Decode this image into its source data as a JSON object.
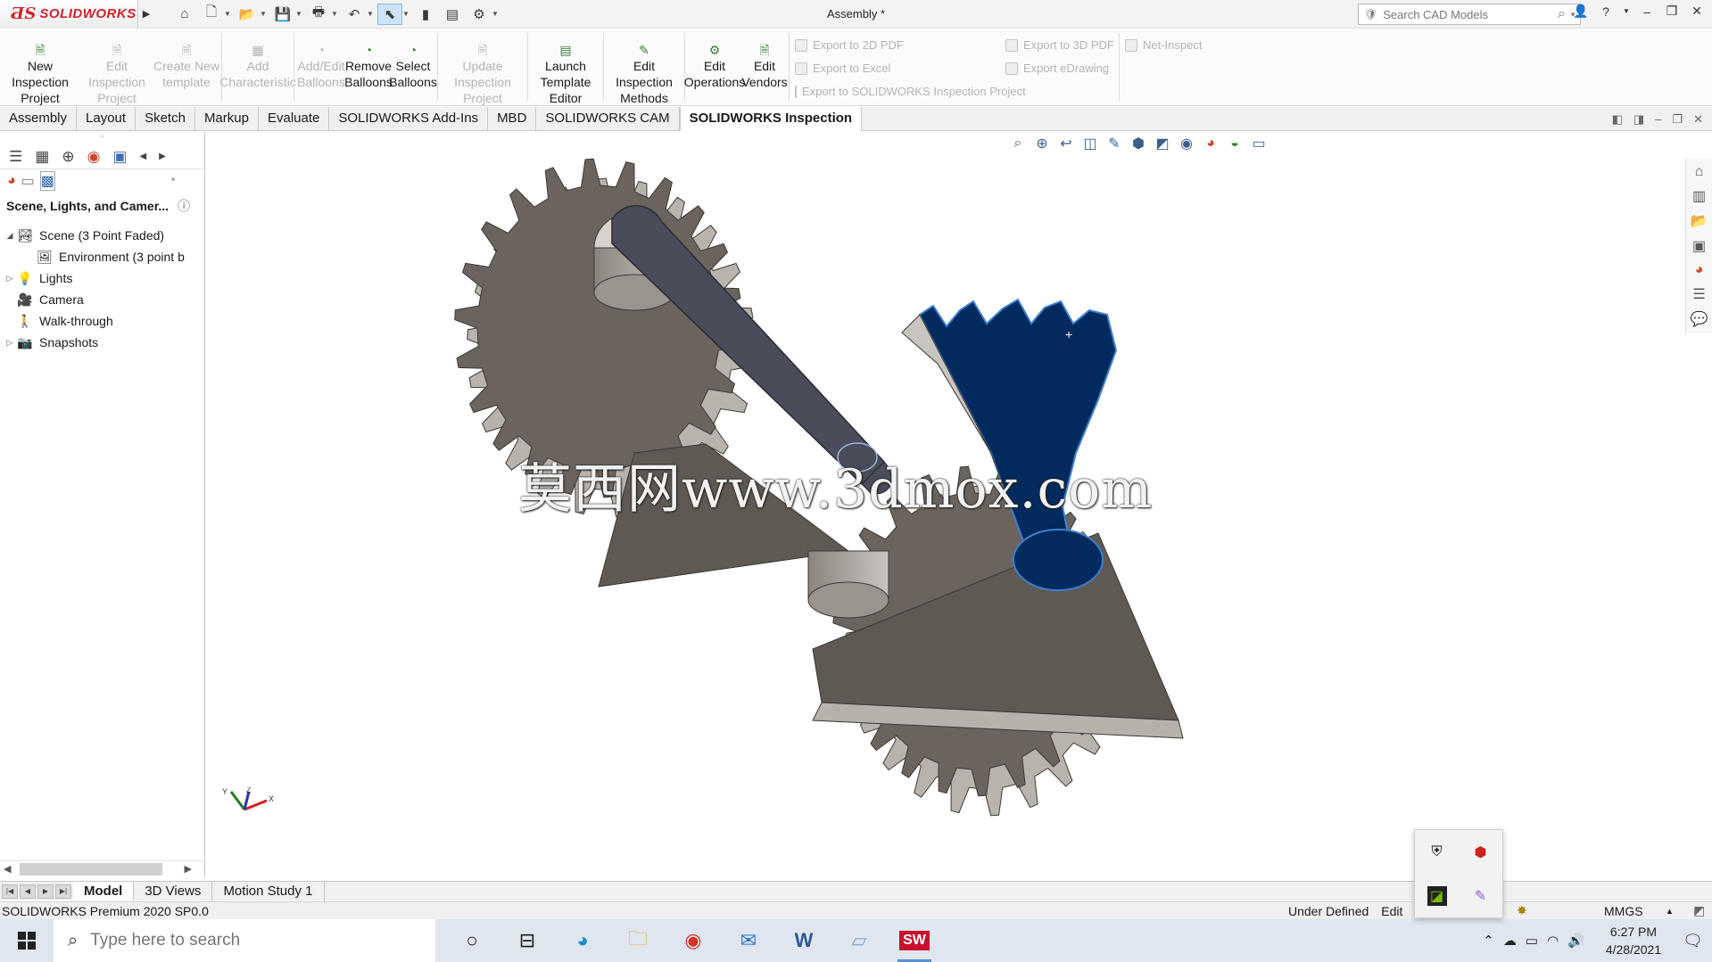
{
  "app": {
    "brand": "SOLIDWORKS",
    "document_title": "Assembly *",
    "search_placeholder": "Search CAD Models"
  },
  "command_manager": {
    "buttons": [
      {
        "label": "New Inspection\nProject",
        "enabled": true
      },
      {
        "label": "Edit Inspection\nProject",
        "enabled": false
      },
      {
        "label": "Create New\ntemplate",
        "enabled": false
      },
      {
        "label": "Add\nCharacteristic",
        "enabled": false
      },
      {
        "label": "Add/Edit\nBalloons",
        "enabled": false
      },
      {
        "label": "Remove\nBalloons",
        "enabled": true
      },
      {
        "label": "Select\nBalloons",
        "enabled": true
      },
      {
        "label": "Update Inspection\nProject",
        "enabled": false
      },
      {
        "label": "Launch\nTemplate Editor",
        "enabled": true
      },
      {
        "label": "Edit Inspection\nMethods",
        "enabled": true
      },
      {
        "label": "Edit\nOperations",
        "enabled": true
      },
      {
        "label": "Edit\nVendors",
        "enabled": true
      }
    ],
    "export_left": [
      "Export to 2D PDF",
      "Export to Excel",
      "Export to SOLIDWORKS Inspection Project"
    ],
    "export_right": [
      "Export to 3D PDF",
      "Export eDrawing"
    ],
    "net_inspect": "Net-Inspect"
  },
  "tabs": [
    "Assembly",
    "Layout",
    "Sketch",
    "Markup",
    "Evaluate",
    "SOLIDWORKS Add-Ins",
    "MBD",
    "SOLIDWORKS CAM",
    "SOLIDWORKS Inspection"
  ],
  "active_tab": "SOLIDWORKS Inspection",
  "left_panel": {
    "header": "Scene, Lights, and Camer...",
    "tree": [
      {
        "label": "Scene (3 Point Faded)",
        "expand": "open",
        "indent": 0
      },
      {
        "label": "Environment (3 point b",
        "expand": "none",
        "indent": 1
      },
      {
        "label": "Lights",
        "expand": "closed",
        "indent": 0
      },
      {
        "label": "Camera",
        "expand": "none",
        "indent": 0
      },
      {
        "label": "Walk-through",
        "expand": "none",
        "indent": 0
      },
      {
        "label": "Snapshots",
        "expand": "closed",
        "indent": 0
      }
    ]
  },
  "viewport": {
    "watermark": "莫西网www.3dmox.com",
    "triad": {
      "x": "X",
      "y": "Y",
      "z": "Z"
    }
  },
  "bottom_tabs": [
    "Model",
    "3D Views",
    "Motion Study 1"
  ],
  "active_bottom_tab": "Model",
  "status_bar": {
    "version": "SOLIDWORKS Premium 2020 SP0.0",
    "state": "Under Defined",
    "mode": "Edit",
    "units": "MMGS"
  },
  "taskbar": {
    "search_placeholder": "Type here to search",
    "time": "6:27 PM",
    "date": "4/28/2021"
  },
  "colors": {
    "selected_part": "#022a5c",
    "gear": "#6b645e",
    "brand_red": "#d2232a"
  }
}
